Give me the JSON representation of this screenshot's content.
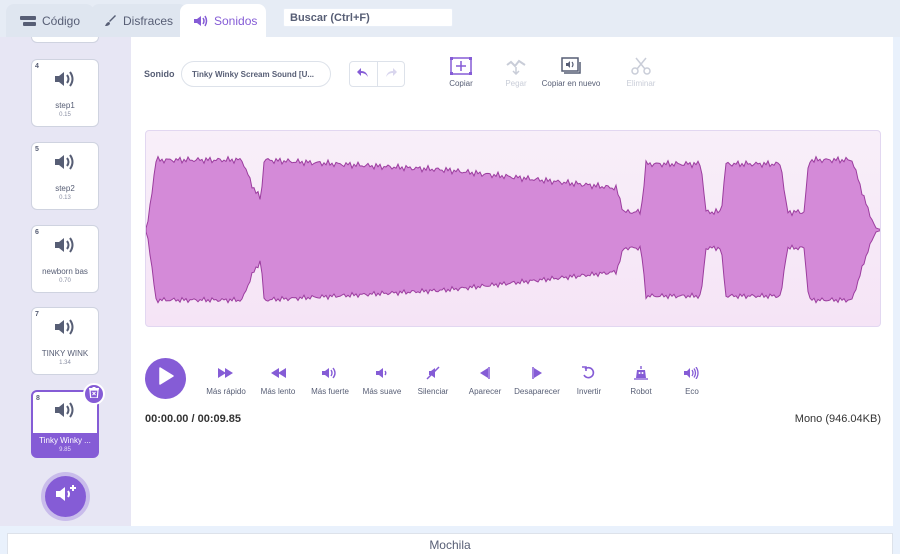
{
  "tabs": {
    "code": "Código",
    "costumes": "Disfraces",
    "sounds": "Sonidos"
  },
  "search": {
    "placeholder": "Buscar (Ctrl+F)"
  },
  "sounds_list": [
    {
      "num": "4",
      "name": "step1",
      "duration": "0.15"
    },
    {
      "num": "5",
      "name": "step2",
      "duration": "0.13"
    },
    {
      "num": "6",
      "name": "newborn bas",
      "duration": "0.70"
    },
    {
      "num": "7",
      "name": "TINKY WINK",
      "duration": "1.34"
    },
    {
      "num": "8",
      "name": "Tinky Winky ...",
      "duration": "9.85"
    }
  ],
  "editor": {
    "sound_label": "Sonido",
    "sound_name": "Tinky Winky Scream Sound [U...",
    "tools": {
      "copy": "Copiar",
      "paste": "Pegar",
      "copy_new": "Copiar en nuevo",
      "delete": "Eliminar"
    },
    "effects": [
      "Más rápido",
      "Más lento",
      "Más fuerte",
      "Más suave",
      "Silenciar",
      "Aparecer",
      "Desaparecer",
      "Invertir",
      "Robot",
      "Eco"
    ],
    "time": "00:00.00 / 00:09.85",
    "meta": "Mono (946.04KB)",
    "wave_color": "#d48ad8",
    "wave_stroke": "#9b3d9e"
  },
  "backpack": "Mochila",
  "accent": "#855cd6"
}
